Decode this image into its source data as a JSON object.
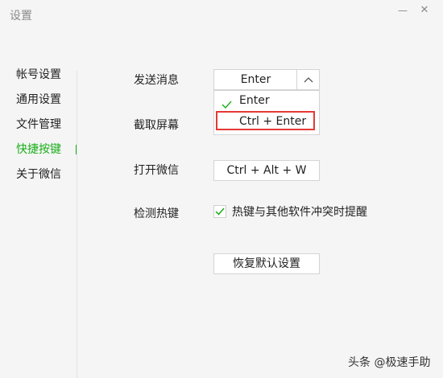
{
  "window": {
    "title": "设置",
    "minimize_label": "—",
    "close_label": "✕"
  },
  "sidebar": {
    "items": [
      {
        "label": "帐号设置"
      },
      {
        "label": "通用设置"
      },
      {
        "label": "文件管理"
      },
      {
        "label": "快捷按键",
        "active": true
      },
      {
        "label": "关于微信"
      }
    ]
  },
  "main": {
    "send_message": {
      "label": "发送消息",
      "selected": "Enter",
      "options": [
        "Enter",
        "Ctrl + Enter"
      ],
      "checked_option": "Enter",
      "highlighted_option": "Ctrl + Enter"
    },
    "screenshot": {
      "label": "截取屏幕"
    },
    "open_wechat": {
      "label": "打开微信",
      "value": "Ctrl + Alt + W"
    },
    "detect_hotkey": {
      "label": "检测热键",
      "checkbox_label": "热键与其他软件冲突时提醒",
      "checked": true
    },
    "reset_button": "恢复默认设置"
  },
  "watermark": "头条 @极速手助",
  "colors": {
    "accent": "#1aad19",
    "highlight": "#e53935"
  }
}
